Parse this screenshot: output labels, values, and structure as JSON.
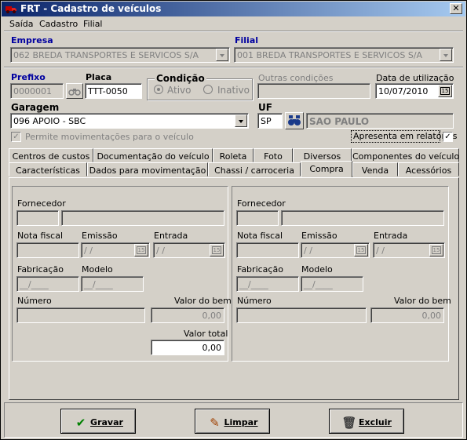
{
  "window": {
    "title": "FRT - Cadastro de veículos",
    "close": "✕"
  },
  "menu": [
    "Saída",
    "Cadastro",
    "Filial"
  ],
  "empresa": {
    "label": "Empresa",
    "value": "062 BREDA TRANSPORTES E SERVICOS S/A"
  },
  "filial": {
    "label": "Filial",
    "value": "001 BREDA TRANSPORTES E SERVICOS S/A"
  },
  "prefixo": {
    "label": "Prefixo",
    "value": "0000001"
  },
  "placa": {
    "label": "Placa",
    "value": "TTT-0050"
  },
  "condicao": {
    "label": "Condição",
    "ativo": "Ativo",
    "inativo": "Inativo"
  },
  "outras": {
    "label": "Outras condições",
    "value": ""
  },
  "data_utilizacao": {
    "label": "Data de utilização",
    "value": "10/07/2010"
  },
  "garagem": {
    "label": "Garagem",
    "value": "096 APOIO - SBC"
  },
  "uf": {
    "label": "UF",
    "value": "SP",
    "state_name": "SAO PAULO"
  },
  "permite": "Permite movimentações para o veículo",
  "apresenta": "Apresenta em relatórios",
  "tabs_row1": [
    "Centros de custos",
    "Documentação do veículo",
    "Roleta",
    "Foto",
    "Diversos",
    "Componentes do veículo"
  ],
  "tabs_row2": [
    "Características",
    "Dados para movimentação",
    "Chassi / carroceria",
    "Compra",
    "Venda",
    "Acessórios"
  ],
  "compra": {
    "fornecedor": "Fornecedor",
    "nota": "Nota fiscal",
    "emissao": "Emissão",
    "entrada": "Entrada",
    "fabricacao": "Fabricação",
    "modelo": "Modelo",
    "numero": "Número",
    "valor_bem": "Valor do bem",
    "valor_total": "Valor total",
    "date_mask": " / / ",
    "year_mask": "__/____",
    "zero": "0,00"
  },
  "buttons": {
    "gravar": "Gravar",
    "limpar": "Limpar",
    "excluir": "Excluir"
  },
  "cal_icon": "15"
}
